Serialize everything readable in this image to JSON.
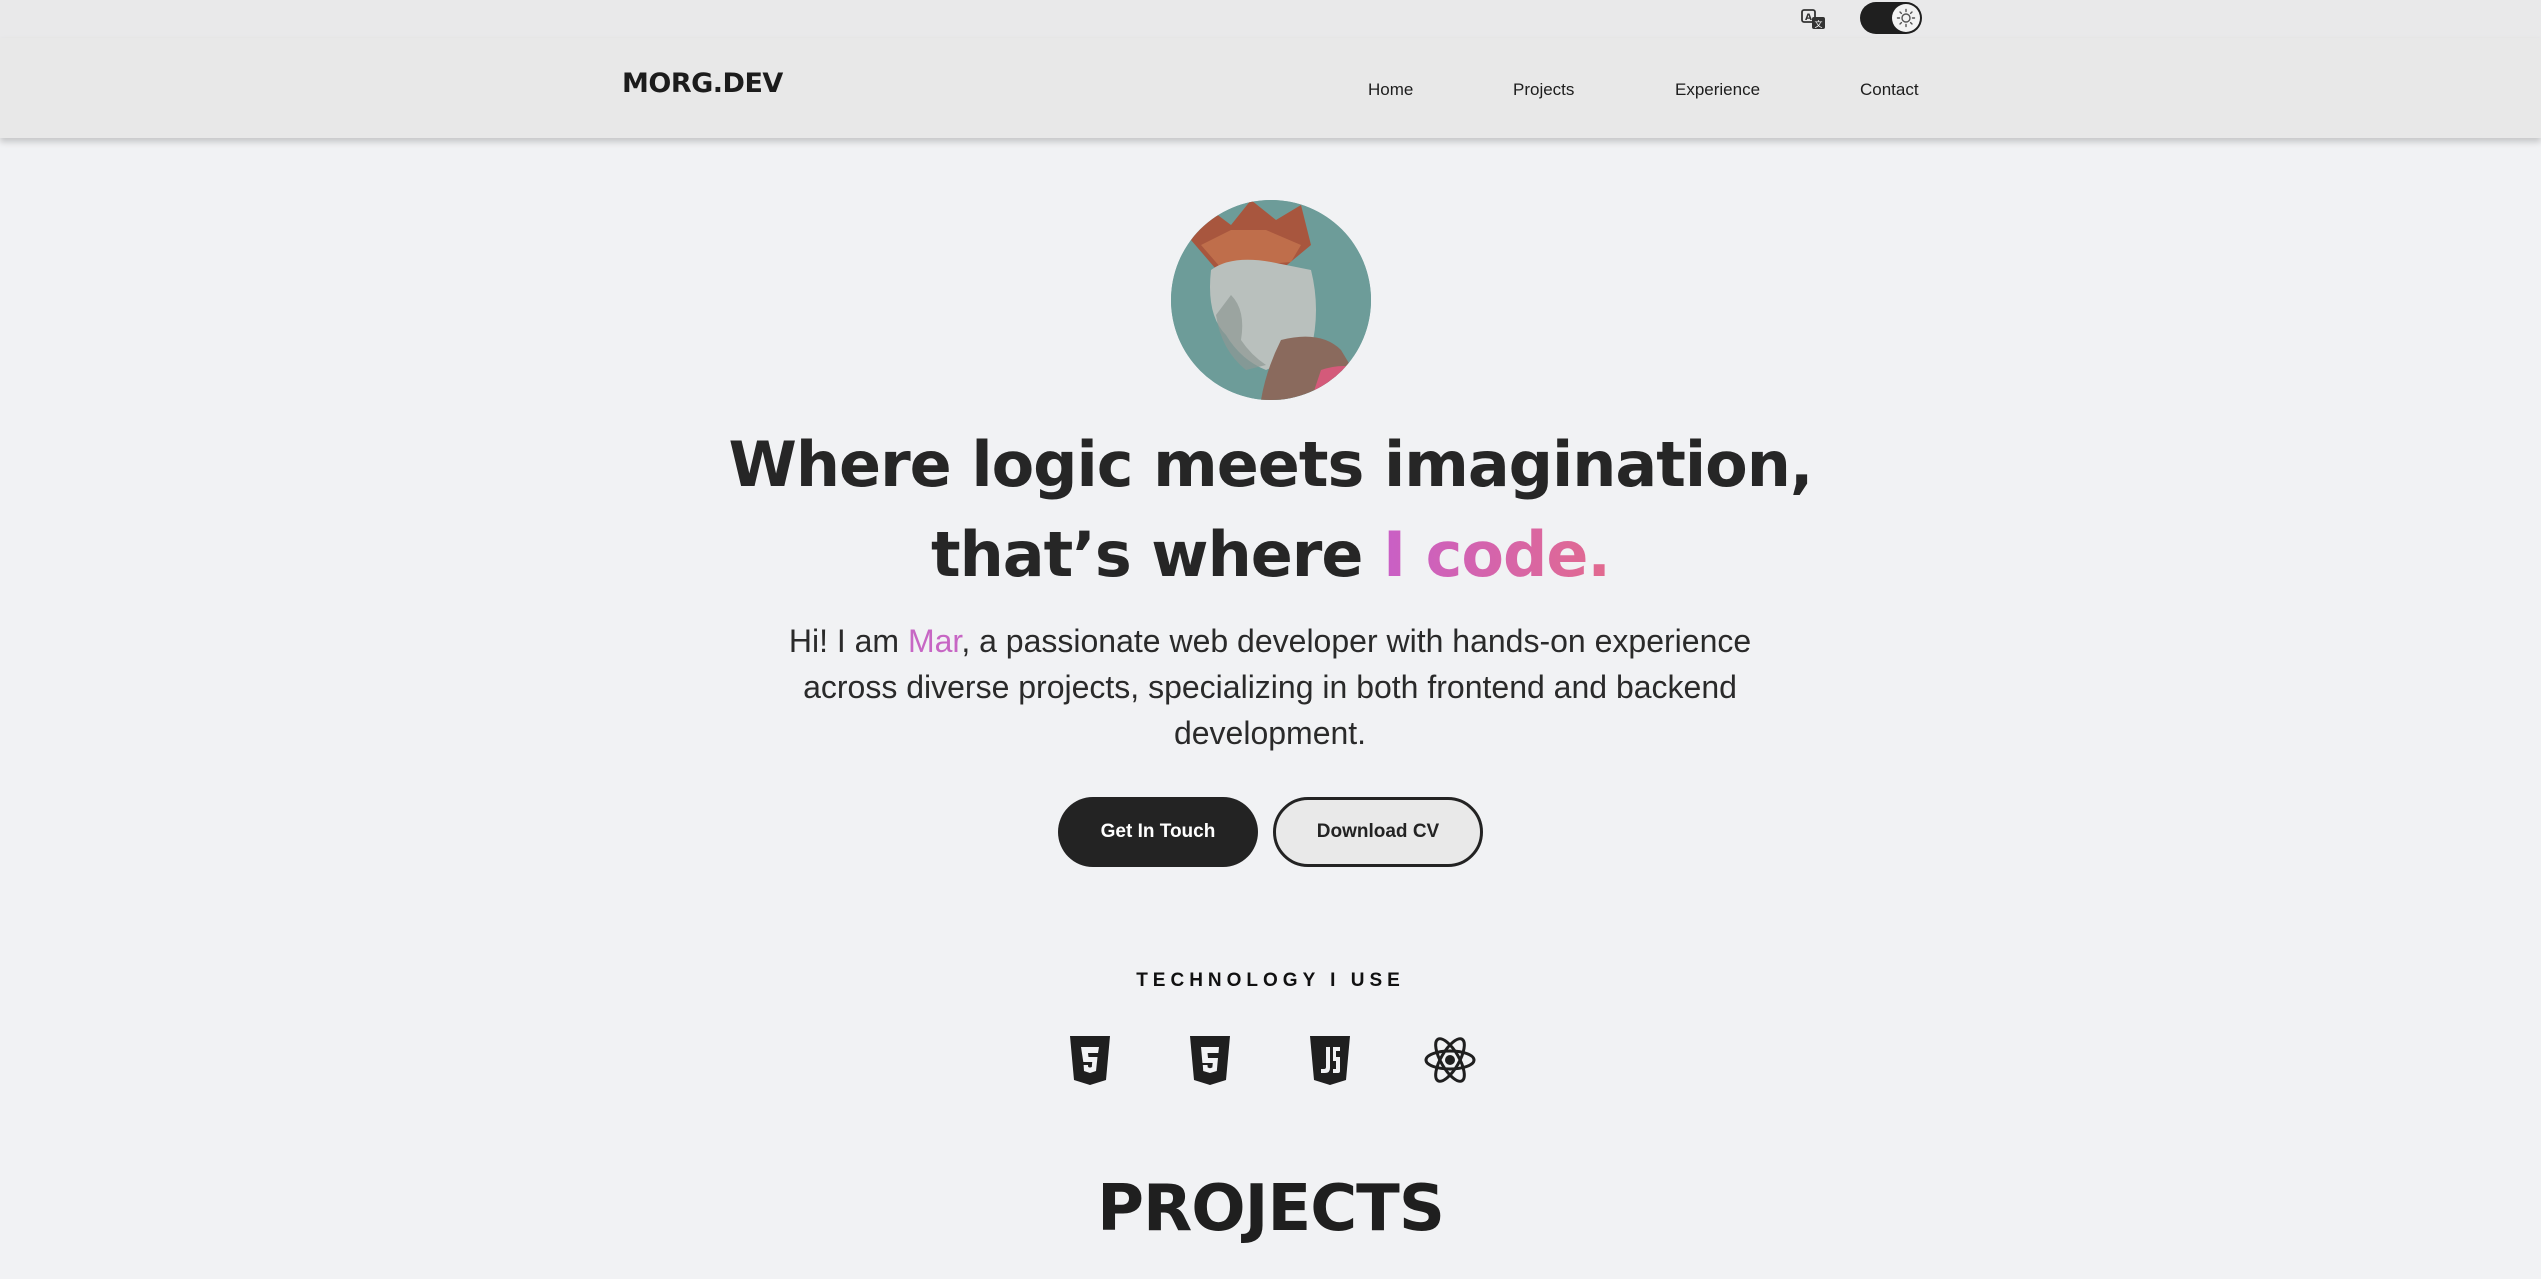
{
  "logo": "MORG.DEV",
  "nav": {
    "items": [
      "Home",
      "Projects",
      "Experience",
      "Contact"
    ]
  },
  "utility": {
    "translate_icon": "translate-icon",
    "theme_icon": "sun-icon"
  },
  "hero": {
    "headline_line1": "Where logic meets imagination,",
    "headline_line2_prefix": "that’s where ",
    "headline_line2_accent": "I code.",
    "intro_prefix": "Hi! I am ",
    "intro_name": "Mar",
    "intro_suffix": ", a passionate web developer with hands-on experience across diverse projects, specializing in both frontend and backend development.",
    "primary_button": "Get In Touch",
    "secondary_button": "Download CV",
    "accent_gradient": [
      "#c95fc6",
      "#e26a8e"
    ]
  },
  "technology": {
    "title": "TECHNOLOGY I USE",
    "icons": [
      "css3-icon",
      "html5-icon",
      "javascript-icon",
      "react-icon"
    ]
  },
  "projects": {
    "title": "PROJECTS"
  },
  "colors": {
    "background": "#f1f2f4",
    "navbar": "#e8e8e8",
    "text_dark": "#232323",
    "accent": "#c766c4"
  }
}
